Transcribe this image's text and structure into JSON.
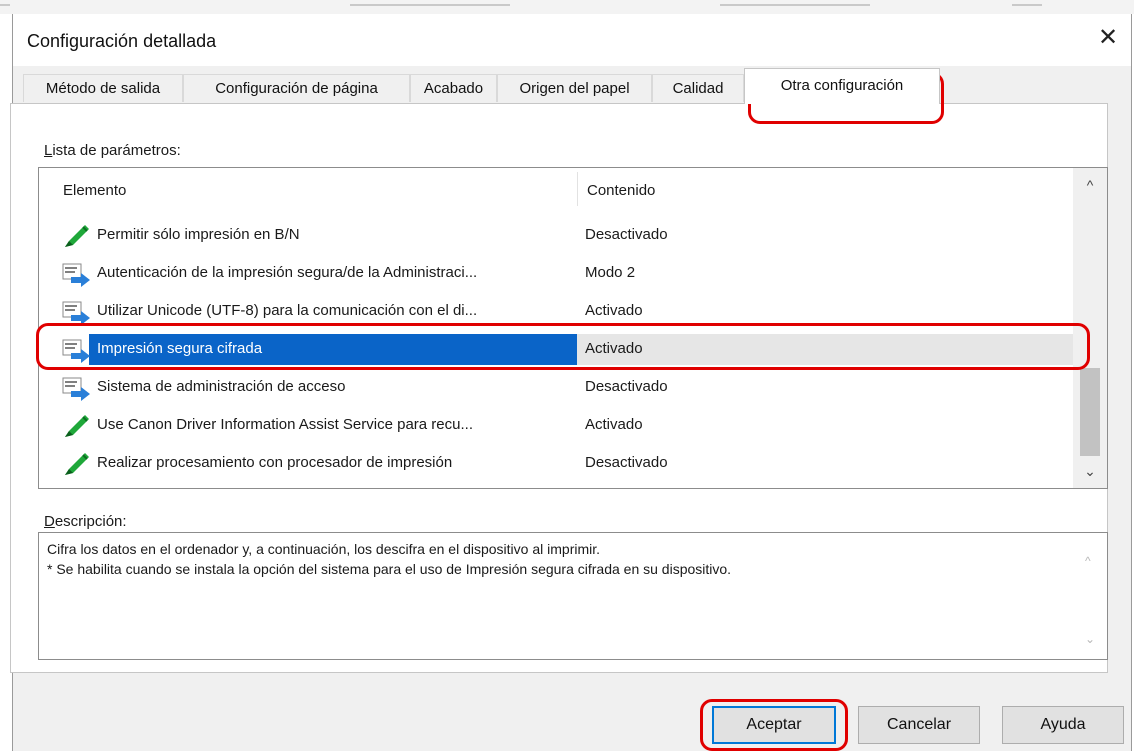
{
  "window": {
    "title": "Configuración detallada",
    "close_glyph": "✕"
  },
  "tabs": [
    {
      "label": "Método de salida",
      "active": false
    },
    {
      "label": "Configuración de página",
      "active": false
    },
    {
      "label": "Acabado",
      "active": false
    },
    {
      "label": "Origen del papel",
      "active": false
    },
    {
      "label": "Calidad",
      "active": false
    },
    {
      "label": "Otra configuración",
      "active": true
    }
  ],
  "params": {
    "section_label_u": "L",
    "section_label_rest": "ista de parámetros:",
    "columns": {
      "item": "Elemento",
      "content": "Contenido"
    },
    "rows": [
      {
        "icon": "pencil-icon",
        "name": "Permitir sólo impresión en B/N",
        "value": "Desactivado"
      },
      {
        "icon": "driver-settings-icon",
        "name": "Autenticación de la impresión segura/de la Administraci...",
        "value": "Modo 2"
      },
      {
        "icon": "driver-settings-icon",
        "name": "Utilizar Unicode (UTF-8) para la comunicación con el di...",
        "value": "Activado"
      },
      {
        "icon": "driver-settings-icon",
        "name": "Impresión segura cifrada",
        "value": "Activado",
        "selected": true
      },
      {
        "icon": "driver-settings-icon",
        "name": "Sistema de administración de acceso",
        "value": "Desactivado"
      },
      {
        "icon": "pencil-icon",
        "name": "Use Canon Driver Information Assist Service para recu...",
        "value": "Activado"
      },
      {
        "icon": "pencil-icon",
        "name": "Realizar procesamiento con procesador de impresión",
        "value": "Desactivado"
      }
    ],
    "scroll_up": "^",
    "scroll_down": "⌄",
    "dropdown_glyph": "⌄"
  },
  "description": {
    "label_u": "D",
    "label_rest": "escripción:",
    "lines": [
      "Cifra los datos en el ordenador y, a continuación, los descifra en el dispositivo al imprimir.",
      "* Se habilita cuando se instala la opción del sistema para el uso de Impresión segura cifrada en su dispositivo."
    ],
    "scroll_up": "^",
    "scroll_down": "⌄"
  },
  "buttons": {
    "ok": "Aceptar",
    "cancel": "Cancelar",
    "help": "Ayuda"
  },
  "colors": {
    "selection": "#0a64c8",
    "highlight": "#e00000",
    "pencil": "#1fa83a",
    "arrow": "#2a7fd8"
  }
}
